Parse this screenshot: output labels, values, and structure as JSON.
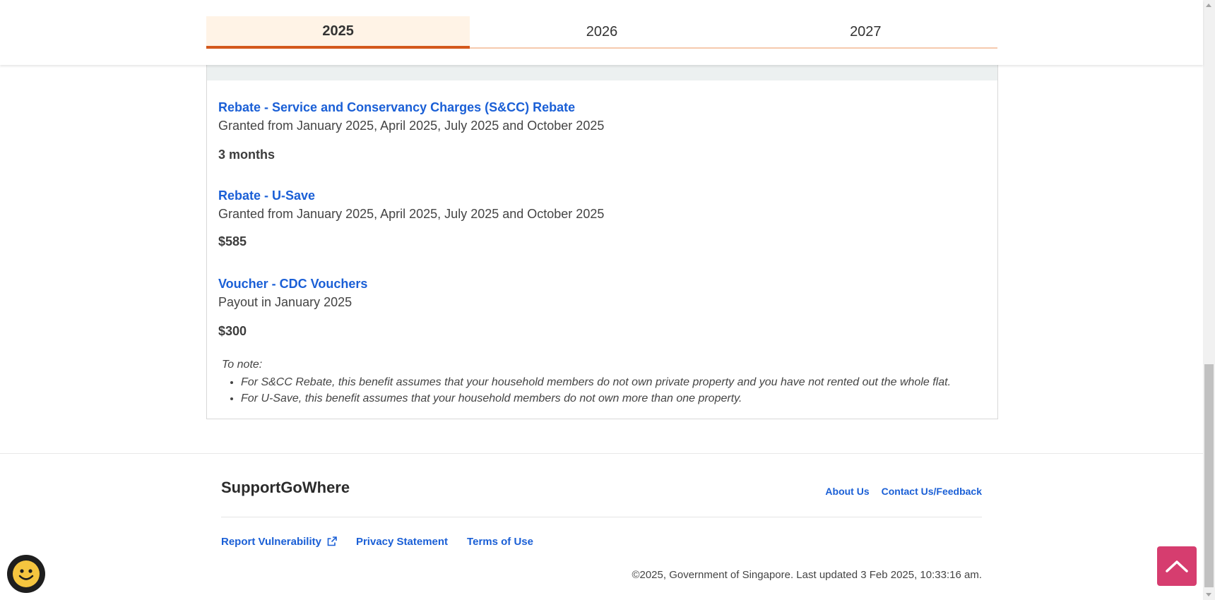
{
  "tabs": {
    "items": [
      {
        "label": "2025",
        "active": true
      },
      {
        "label": "2026",
        "active": false
      },
      {
        "label": "2027",
        "active": false
      }
    ]
  },
  "benefits": [
    {
      "title": "Rebate - Service and Conservancy Charges (S&CC) Rebate",
      "description": "Granted from January 2025, April 2025, July 2025 and October 2025",
      "value": "3 months"
    },
    {
      "title": "Rebate - U-Save",
      "description": "Granted from January 2025, April 2025, July 2025 and October 2025",
      "value": "$585"
    },
    {
      "title": "Voucher - CDC Vouchers",
      "description": "Payout in January 2025",
      "value": "$300"
    }
  ],
  "notes": {
    "title": "To note:",
    "items": [
      "For S&CC Rebate, this benefit assumes that your household members do not own private property and you have not rented out the whole flat.",
      "For U-Save, this benefit assumes that your household members do not own more than one property."
    ]
  },
  "footer": {
    "brand": "SupportGoWhere",
    "top_links": {
      "about": "About Us",
      "contact": "Contact Us/Feedback"
    },
    "bottom_links": {
      "report": "Report Vulnerability",
      "privacy": "Privacy Statement",
      "terms": "Terms of Use"
    },
    "copyright": "©2025, Government of Singapore. Last updated 3 Feb 2025, 10:33:16 am."
  },
  "colors": {
    "link": "#1a5fd6",
    "tab_active_underline": "#d4581c",
    "tab_active_bg": "#fff3e6",
    "back_to_top": "#d63d6f",
    "chat_face": "#f5c53f"
  },
  "icons": {
    "external": "external-link-icon",
    "back_to_top": "chevron-up-icon",
    "chat": "smiley-face-icon"
  }
}
